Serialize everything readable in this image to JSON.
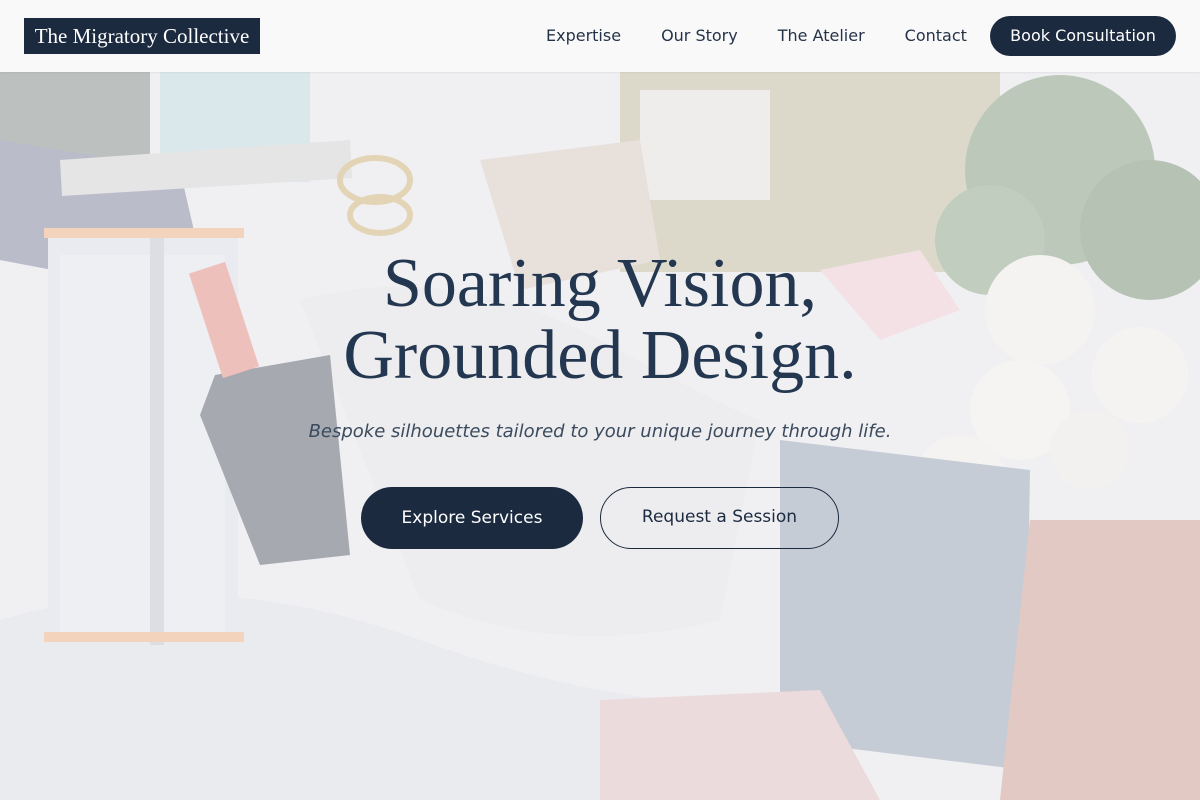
{
  "nav": {
    "logo": "The Migratory Collective",
    "links": [
      "Expertise",
      "Our Story",
      "The Atelier",
      "Contact"
    ],
    "cta": "Book Consultation"
  },
  "hero": {
    "title_line1": "Soaring Vision,",
    "title_line2": "Grounded Design.",
    "subtitle": "Bespoke silhouettes tailored to your unique journey through life.",
    "primary_button": "Explore Services",
    "secondary_button": "Request a Session"
  },
  "colors": {
    "navy": "#1c2a40",
    "title": "#243750"
  }
}
